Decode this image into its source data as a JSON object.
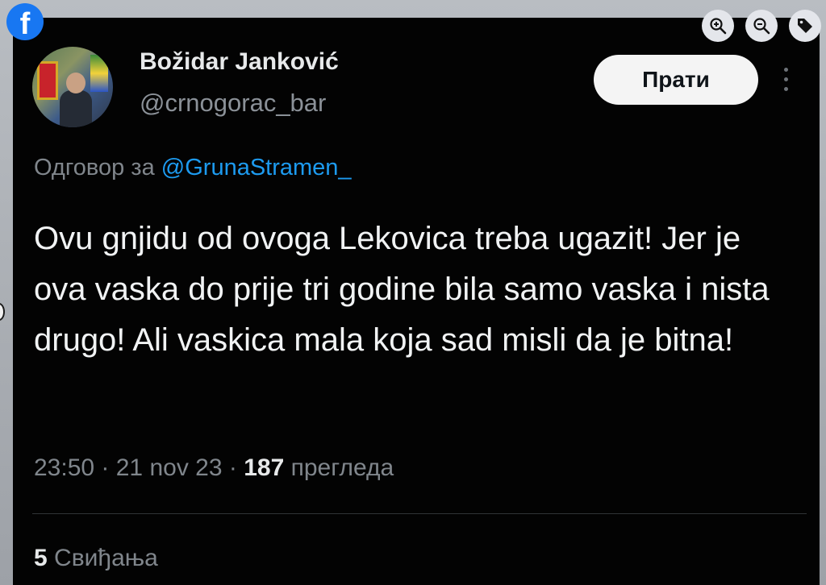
{
  "app": {
    "logo_glyph": "f",
    "brand_color": "#1877f2"
  },
  "viewer_tools": [
    {
      "name": "zoom-in-icon"
    },
    {
      "name": "zoom-out-icon"
    },
    {
      "name": "tag-icon"
    }
  ],
  "tweet": {
    "author_name": "Božidar Janković",
    "author_handle": "@crnogorac_bar",
    "follow_label": "Прати",
    "reply_prefix": "Одговор за",
    "reply_mention": "@GrunaStramen_",
    "text": "Ovu gnjidu od ovoga Lekovica treba ugazit! Jer je ova vaska do prije tri godine bila samo vaska i nista drugo! Ali vaskica mala koja sad misli da je bitna!",
    "time": "23:50",
    "date": "21 nov 23",
    "views_count": "187",
    "views_label": "прегледа",
    "likes_count": "5",
    "likes_label": "Свиђања",
    "colors": {
      "background": "#030303",
      "link": "#1d9bf0",
      "muted": "#80868c"
    }
  }
}
